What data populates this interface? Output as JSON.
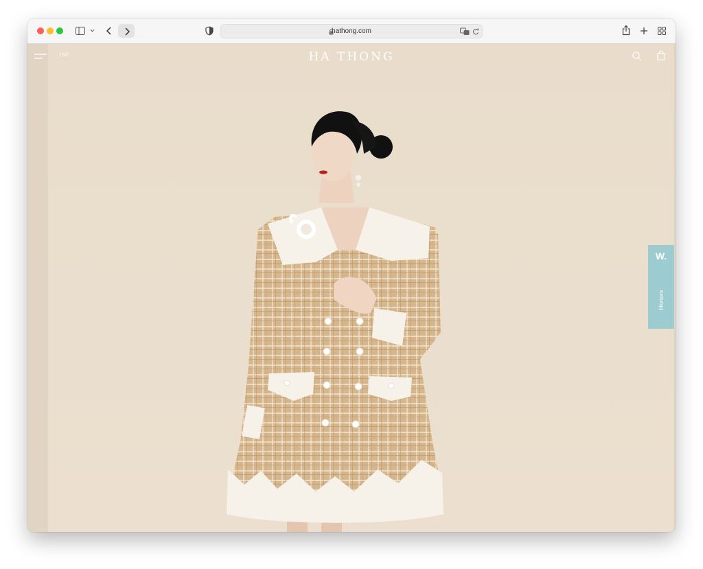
{
  "browser": {
    "url": "hathong.com",
    "traffic_lights": {
      "close": "#fe5f57",
      "minimize": "#febc2e",
      "maximize": "#28c840"
    }
  },
  "site": {
    "logo": "HA THONG",
    "language": "ISO",
    "honors_tab": {
      "letter": "W.",
      "label": "Honors",
      "color": "#9ccbd0"
    }
  },
  "icons": {
    "menu": "hamburger-menu-icon",
    "search": "search-icon",
    "cart": "shopping-bag-icon"
  },
  "colors": {
    "background": "#e9dccb",
    "dress_tweed": "#d8b88f",
    "dress_trim": "#f6f2ea"
  }
}
